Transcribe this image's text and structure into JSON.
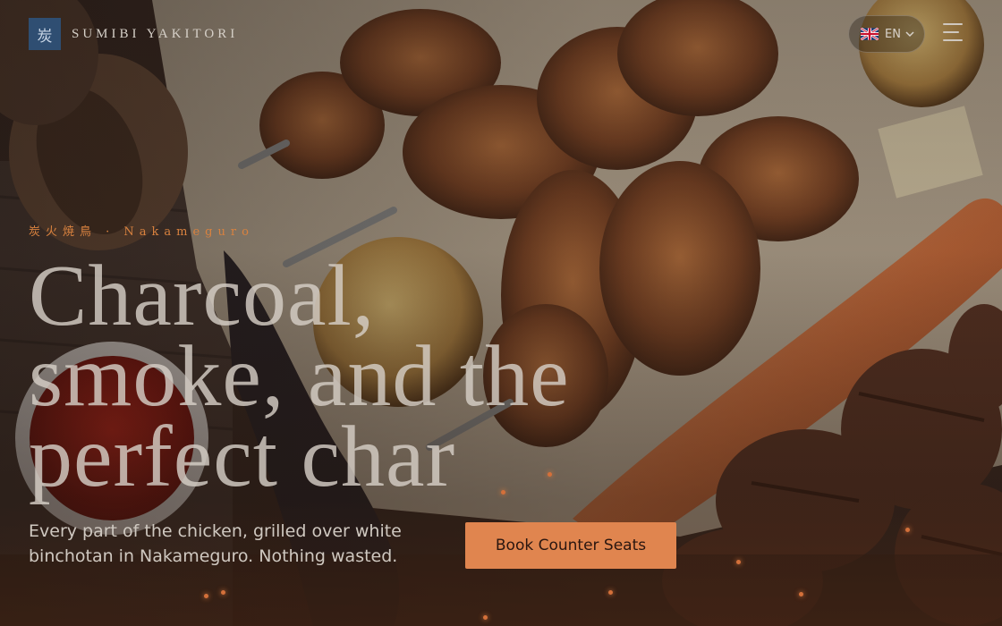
{
  "brand": {
    "mark": "炭",
    "name": "SUMIBI YAKITORI"
  },
  "language": {
    "code": "EN",
    "flag_icon": "uk-flag-icon"
  },
  "menu_icon": "hamburger-menu-icon",
  "hero": {
    "kicker": "炭火焼鳥 · Nakameguro",
    "headline_lines": [
      "Charcoal,",
      "smoke, and the",
      "perfect char"
    ],
    "subtext": "Every part of the chicken, grilled over white binchotan in Nakameguro. Nothing wasted.",
    "cta_label": "Book Counter Seats"
  },
  "colors": {
    "accent": "#e0854f",
    "kicker": "#d9823f",
    "logo_bg": "#2f4e72"
  }
}
